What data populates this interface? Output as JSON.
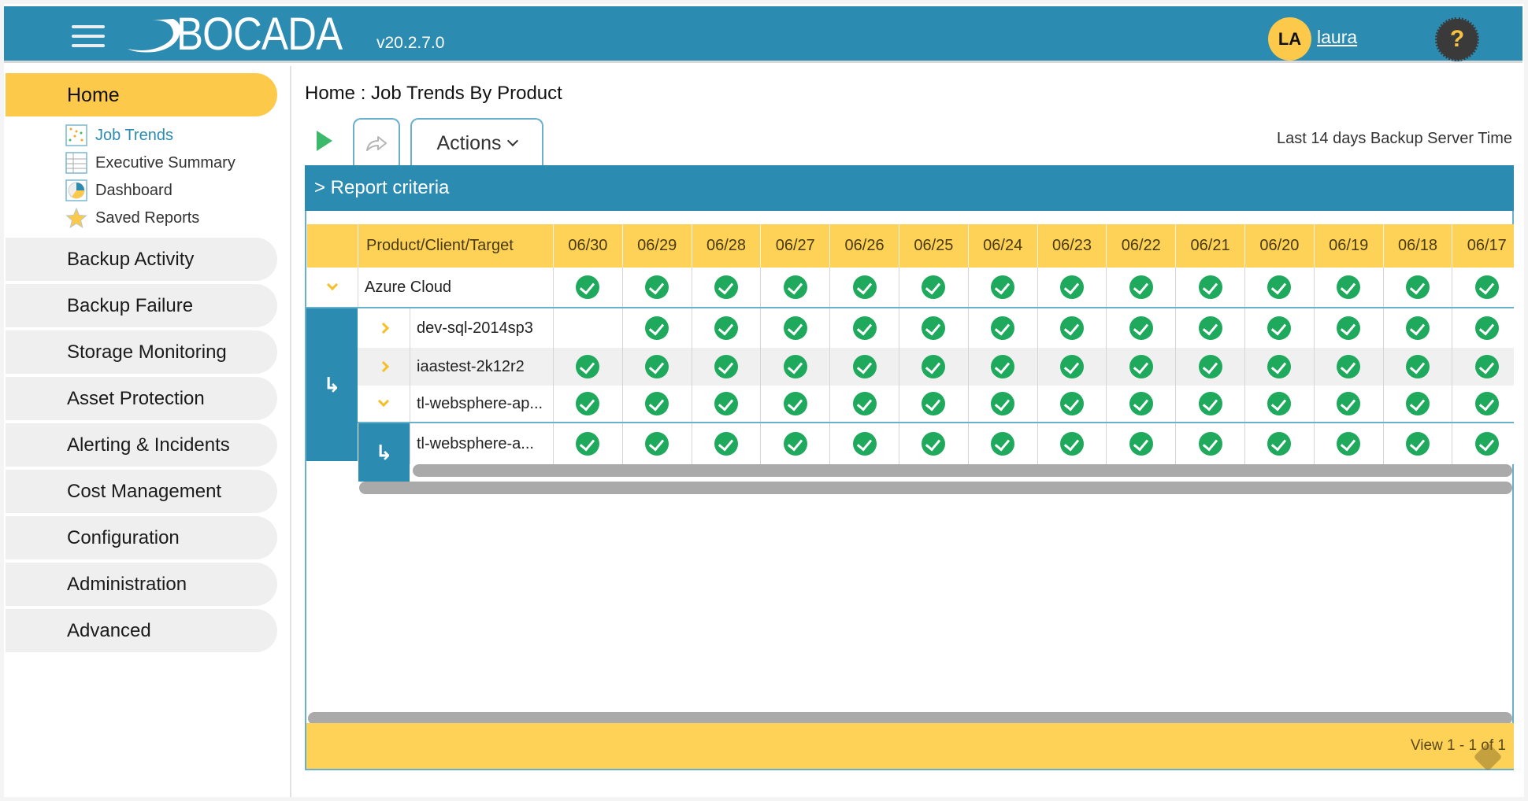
{
  "header": {
    "logo_text": "BOCADA",
    "version": "v20.2.7.0",
    "user_initials": "LA",
    "username": "laura",
    "help_label": "?"
  },
  "sidebar": {
    "home_label": "Home",
    "sub_items": [
      {
        "label": "Job Trends",
        "icon": "scatter-chart-icon",
        "active": true
      },
      {
        "label": "Executive Summary",
        "icon": "table-icon",
        "active": false
      },
      {
        "label": "Dashboard",
        "icon": "pie-chart-icon",
        "active": false
      },
      {
        "label": "Saved Reports",
        "icon": "star-icon",
        "active": false
      }
    ],
    "items": [
      {
        "label": "Backup Activity"
      },
      {
        "label": "Backup Failure"
      },
      {
        "label": "Storage Monitoring"
      },
      {
        "label": "Asset Protection"
      },
      {
        "label": "Alerting & Incidents"
      },
      {
        "label": "Cost Management"
      },
      {
        "label": "Configuration"
      },
      {
        "label": "Administration"
      },
      {
        "label": "Advanced"
      }
    ]
  },
  "main": {
    "page_title": "Home : Job Trends By Product",
    "toolbar": {
      "run_icon": "play-icon",
      "share_icon": "share-arrow-icon",
      "actions_label": "Actions",
      "time_range": "Last 14 days Backup Server Time"
    },
    "criteria_label": "> Report criteria",
    "table": {
      "name_header": "Product/Client/Target",
      "dates": [
        "06/30",
        "06/29",
        "06/28",
        "06/27",
        "06/26",
        "06/25",
        "06/24",
        "06/23",
        "06/22",
        "06/21",
        "06/20",
        "06/19",
        "06/18",
        "06/17"
      ],
      "rows": [
        {
          "name": "Azure Cloud",
          "level": 0,
          "expander": "collapse",
          "status": [
            "success",
            "success",
            "success",
            "success",
            "success",
            "success",
            "success",
            "success",
            "success",
            "success",
            "success",
            "success",
            "success",
            "success"
          ]
        },
        {
          "name": "dev-sql-2014sp3",
          "level": 1,
          "expander": "expand",
          "status": [
            "none",
            "success",
            "success",
            "success",
            "success",
            "success",
            "success",
            "success",
            "success",
            "success",
            "success",
            "success",
            "success",
            "success"
          ]
        },
        {
          "name": "iaastest-2k12r2",
          "level": 1,
          "expander": "expand",
          "status": [
            "success",
            "success",
            "success",
            "success",
            "success",
            "success",
            "success",
            "success",
            "success",
            "success",
            "success",
            "success",
            "success",
            "success"
          ]
        },
        {
          "name": "tl-websphere-ap...",
          "level": 1,
          "expander": "collapse",
          "status": [
            "success",
            "success",
            "success",
            "success",
            "success",
            "success",
            "success",
            "success",
            "success",
            "success",
            "success",
            "success",
            "success",
            "success"
          ]
        },
        {
          "name": "tl-websphere-a...",
          "level": 2,
          "expander": "none",
          "status": [
            "success",
            "success",
            "success",
            "success",
            "success",
            "success",
            "success",
            "success",
            "success",
            "success",
            "success",
            "success",
            "success",
            "success"
          ]
        }
      ]
    },
    "footer": {
      "pager_text": "View 1 - 1 of 1"
    }
  }
}
